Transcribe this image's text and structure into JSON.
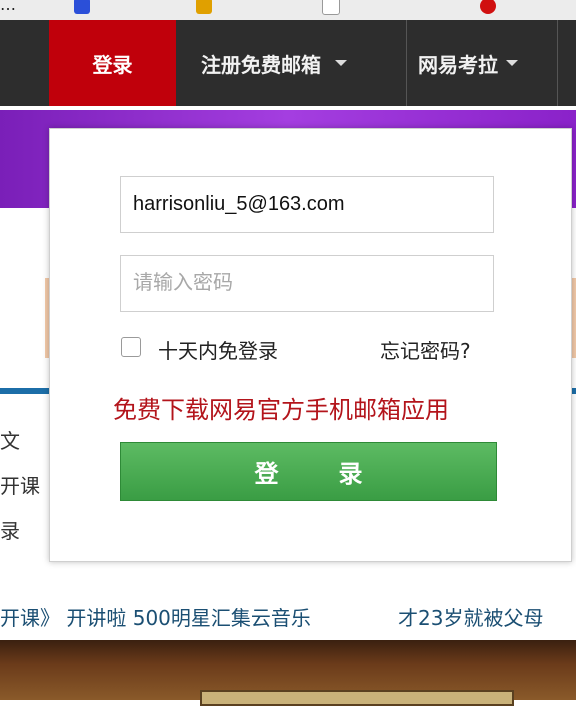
{
  "nav": {
    "login": "登录",
    "register": "注册免费邮箱",
    "kaola": "网易考拉"
  },
  "login_popup": {
    "username_value": "harrisonliu_5@163.com",
    "password_placeholder": "请输入密码",
    "remember_label": "十天内免登录",
    "forgot_label": "忘记密码?",
    "app_promo": "免费下载网易官方手机邮箱应用",
    "login_button": "登　录"
  },
  "ticker": {
    "left": "开课》 开讲啦 500明星汇集云音乐",
    "right": "才23岁就被父母"
  },
  "side_text": [
    "文",
    "开课",
    "录"
  ],
  "colors": {
    "nav_bg": "#2d2d2d",
    "login_tab": "#c0000b",
    "button_green": "#3a9d44",
    "promo_red": "#b3141b"
  },
  "icons": {
    "nav_caret": "chevron-down-icon"
  }
}
